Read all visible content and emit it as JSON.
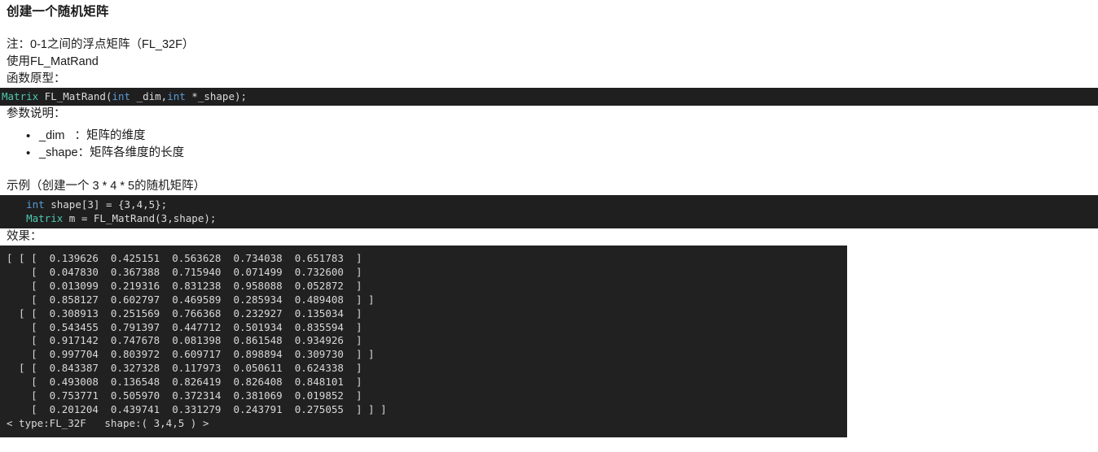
{
  "document": {
    "title": "创建一个随机矩阵",
    "note_line": "注：0-1之间的浮点矩阵（FL_32F）",
    "usage_line": "使用FL_MatRand",
    "prototype_label": "函数原型：",
    "params_label": "参数说明：",
    "example_label": "示例（创建一个 3 * 4 * 5的随机矩阵）",
    "result_label": "效果："
  },
  "prototype_code": {
    "type_token": "Matrix",
    "fn_name": " FL_MatRand(",
    "kw1": "int",
    "arg1": " _dim,",
    "kw2": "int",
    "arg2": " *_shape);"
  },
  "params": [
    {
      "name": "_dim",
      "sep": "   ：",
      "desc": "矩阵的维度",
      "text": "_dim   ：矩阵的维度"
    },
    {
      "name": "_shape",
      "sep": "：",
      "desc": "矩阵各维度的长度",
      "text": "_shape：矩阵各维度的长度"
    }
  ],
  "example_code": {
    "line1_kw": "int",
    "line1_rest": " shape[3] = {3,4,5};",
    "line2_type": "Matrix",
    "line2_rest": " m = FL_MatRand(3,shape);",
    "line1_indent": "    ",
    "line2_indent": "    "
  },
  "console_output": {
    "lines": [
      "[ [ [  0.139626  0.425151  0.563628  0.734038  0.651783  ]",
      "    [  0.047830  0.367388  0.715940  0.071499  0.732600  ]",
      "    [  0.013099  0.219316  0.831238  0.958088  0.052872  ]",
      "    [  0.858127  0.602797  0.469589  0.285934  0.489408  ] ]",
      "  [ [  0.308913  0.251569  0.766368  0.232927  0.135034  ]",
      "    [  0.543455  0.791397  0.447712  0.501934  0.835594  ]",
      "    [  0.917142  0.747678  0.081398  0.861548  0.934926  ]",
      "    [  0.997704  0.803972  0.609717  0.898894  0.309730  ] ]",
      "  [ [  0.843387  0.327328  0.117973  0.050611  0.624338  ]",
      "    [  0.493008  0.136548  0.826419  0.826408  0.848101  ]",
      "    [  0.753771  0.505970  0.372314  0.381069  0.019852  ]",
      "    [  0.201204  0.439741  0.331279  0.243791  0.275055  ] ] ]"
    ],
    "footer": "< type:FL_32F   shape:( 3,4,5 ) >",
    "matrix_values": [
      [
        [
          0.139626,
          0.425151,
          0.563628,
          0.734038,
          0.651783
        ],
        [
          0.04783,
          0.367388,
          0.71594,
          0.071499,
          0.7326
        ],
        [
          0.013099,
          0.219316,
          0.831238,
          0.958088,
          0.052872
        ],
        [
          0.858127,
          0.602797,
          0.469589,
          0.285934,
          0.489408
        ]
      ],
      [
        [
          0.308913,
          0.251569,
          0.766368,
          0.232927,
          0.135034
        ],
        [
          0.543455,
          0.791397,
          0.447712,
          0.501934,
          0.835594
        ],
        [
          0.917142,
          0.747678,
          0.081398,
          0.861548,
          0.934926
        ],
        [
          0.997704,
          0.803972,
          0.609717,
          0.898894,
          0.30973
        ]
      ],
      [
        [
          0.843387,
          0.327328,
          0.117973,
          0.050611,
          0.624338
        ],
        [
          0.493008,
          0.136548,
          0.826419,
          0.826408,
          0.848101
        ],
        [
          0.753771,
          0.50597,
          0.372314,
          0.381069,
          0.019852
        ],
        [
          0.201204,
          0.439741,
          0.331279,
          0.243791,
          0.275055
        ]
      ]
    ],
    "dtype": "FL_32F",
    "shape": "( 3,4,5 )"
  },
  "colors": {
    "code_background": "#1f1f1f",
    "console_background": "#212121",
    "type_token": "#4ec9b0",
    "keyword_token": "#569cd6",
    "code_foreground": "#d4d4d4",
    "page_background": "#ffffff",
    "text": "#1a1a1a"
  }
}
